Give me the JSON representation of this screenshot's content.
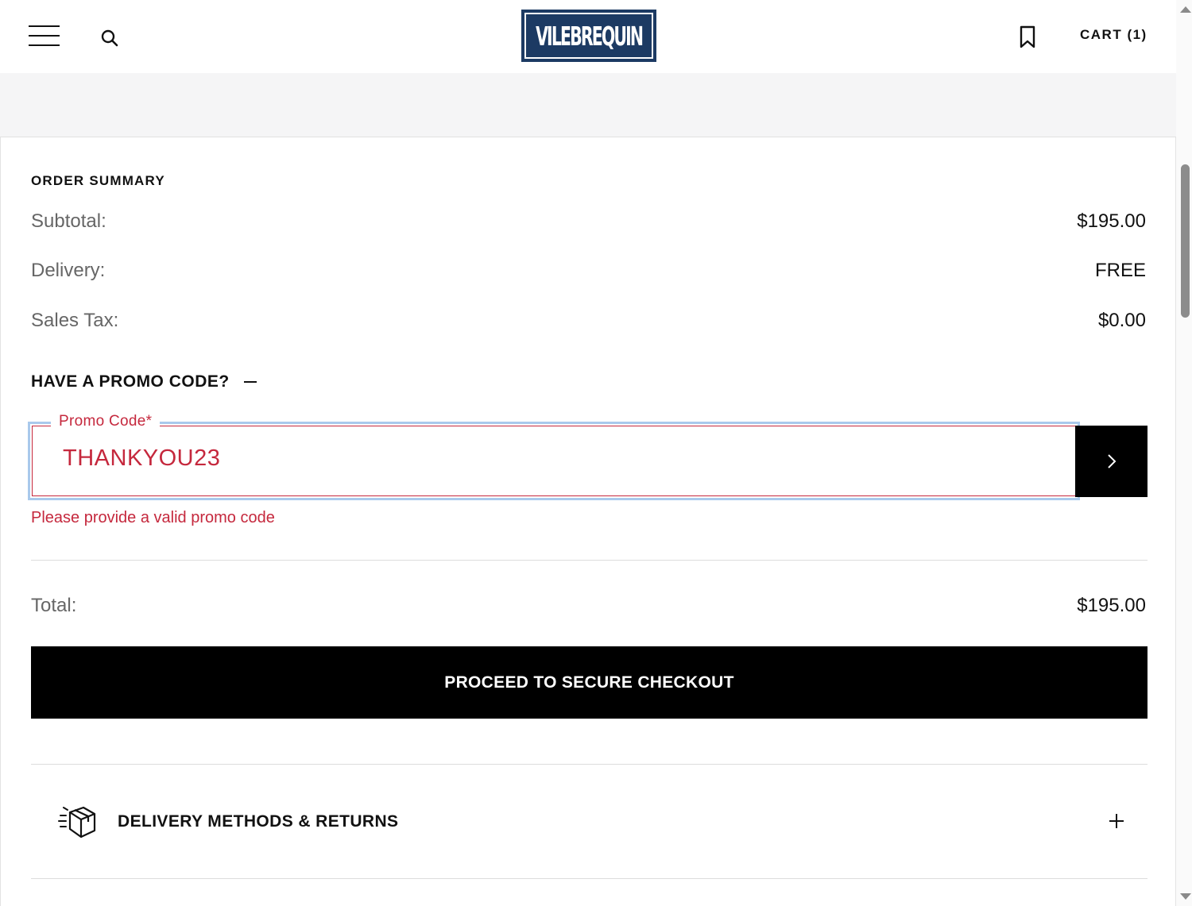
{
  "header": {
    "logo_text": "VILEBREQUIN",
    "cart_label": "CART (1)",
    "icons": [
      "hamburger-menu-icon",
      "search-icon",
      "bookmark-icon"
    ]
  },
  "order_summary": {
    "title": "ORDER SUMMARY",
    "rows": [
      {
        "label": "Subtotal:",
        "value": "$195.00"
      },
      {
        "label": "Delivery:",
        "value": "FREE"
      },
      {
        "label": "Sales Tax:",
        "value": "$0.00"
      }
    ],
    "total": {
      "label": "Total:",
      "value": "$195.00"
    }
  },
  "promo": {
    "toggle_label": "HAVE A PROMO CODE?",
    "field_label": "Promo Code*",
    "value": "THANKYOU23",
    "error": "Please provide a valid promo code",
    "error_color": "#c5283d",
    "focus_color": "#a9c9ec"
  },
  "checkout": {
    "button_label": "PROCEED TO SECURE CHECKOUT"
  },
  "delivery": {
    "label": "DELIVERY METHODS & RETURNS",
    "icon": "box-delivery-icon"
  },
  "colors": {
    "brand": "#1c3a63",
    "primary_button": "#000000",
    "muted_text": "#666666"
  }
}
